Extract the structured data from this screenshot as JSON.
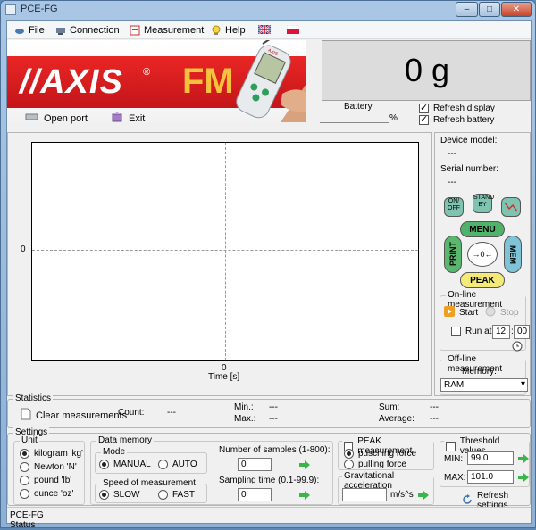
{
  "window": {
    "title": "PCE-FG",
    "min": "–",
    "max": "□",
    "close": "✕"
  },
  "menu": {
    "file": "File",
    "connection": "Connection",
    "measurement": "Measurement",
    "help": "Help"
  },
  "logo": {
    "axis": "//AXIS",
    "reg": "®",
    "fm": "FM",
    "device_text": "AXIS"
  },
  "toolbar": {
    "open_port": "Open port",
    "exit": "Exit"
  },
  "readout": {
    "value": "0 g"
  },
  "battery": {
    "label": "Battery",
    "unit": "%",
    "value": ""
  },
  "refresh": {
    "display": "Refresh display",
    "display_checked": true,
    "battery": "Refresh battery",
    "battery_checked": true
  },
  "plot": {
    "y_tick": "0",
    "x_tick": "0",
    "x_label": "Time [s]"
  },
  "device": {
    "model_label": "Device model:",
    "model_value": "---",
    "serial_label": "Serial number:",
    "serial_value": "---"
  },
  "keypad": {
    "on_off": "ON/\nOFF",
    "stand_by": "STAND\nBY",
    "menu": "MENU",
    "print": "PRINT",
    "mem": "MEM",
    "peak": "PEAK",
    "center": "→0←"
  },
  "online": {
    "title": "On-line measurement",
    "start": "Start",
    "stop": "Stop",
    "run_at": "Run at",
    "hour": "12",
    "minute": "00"
  },
  "offline": {
    "title": "Off-line measurement",
    "memory_label": "Memory:",
    "memory_value": "RAM"
  },
  "statistics": {
    "title": "Statistics",
    "clear": "Clear measurements",
    "count_label": "Count:",
    "count_value": "---",
    "min_label": "Min.:",
    "min_value": "---",
    "max_label": "Max.:",
    "max_value": "---",
    "sum_label": "Sum:",
    "sum_value": "---",
    "average_label": "Average:",
    "average_value": "---"
  },
  "settings": {
    "title": "Settings",
    "unit": {
      "title": "Unit",
      "options": [
        "kilogram 'kg'",
        "Newton 'N'",
        "pound 'lb'",
        "ounce 'oz'"
      ],
      "selected": 0
    },
    "data_memory": {
      "title": "Data memory",
      "mode_title": "Mode",
      "manual": "MANUAL",
      "auto": "AUTO",
      "speed_title": "Speed of measurement",
      "slow": "SLOW",
      "fast": "FAST"
    },
    "samples_label": "Number of samples (1-800):",
    "samples_value": "0",
    "sampling_label": "Sampling time (0.1-99.9):",
    "sampling_value": "0",
    "peak": {
      "label": "PEAK measurement",
      "pushing": "pusching force",
      "pulling": "pulling force"
    },
    "gravity": {
      "title": "Gravitational acceleration",
      "unit": "m/s^s",
      "value": ""
    },
    "threshold": {
      "label": "Threshold values",
      "min_label": "MIN:",
      "min_value": "99.0",
      "max_label": "MAX:",
      "max_value": "101.0",
      "refresh": "Refresh settings"
    }
  },
  "status": {
    "text": "PCE-FG Status"
  },
  "colors": {
    "axis_red": "#d81f20",
    "fm_yellow": "#f6c23d",
    "arrow_green": "#39b54a"
  }
}
